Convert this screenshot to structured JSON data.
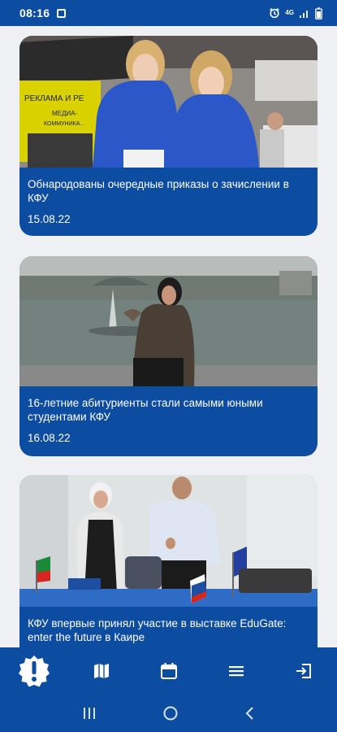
{
  "status_bar": {
    "time": "08:16",
    "network": "4G"
  },
  "news": [
    {
      "title": "Обнародованы очередные приказы о зачислении в КФУ",
      "date": "15.08.22",
      "photo_text_1": "РЕКЛАМА И РЕ",
      "photo_text_2": "МЕДИА-",
      "photo_text_3": "КОММУНИКА..."
    },
    {
      "title": "16-летние абитуриенты стали самыми юными студентами КФУ",
      "date": "16.08.22"
    },
    {
      "title": "КФУ впервые принял участие в выставке EduGate: enter the future в Каире",
      "date": ""
    }
  ],
  "bottom_nav": {
    "items": [
      {
        "icon": "alert-badge-icon",
        "active": true
      },
      {
        "icon": "map-icon"
      },
      {
        "icon": "calendar-icon"
      },
      {
        "icon": "menu-icon"
      },
      {
        "icon": "logout-icon"
      }
    ]
  },
  "colors": {
    "primary": "#0d4da1",
    "background": "#eef0f4",
    "text": "#ffffff"
  }
}
